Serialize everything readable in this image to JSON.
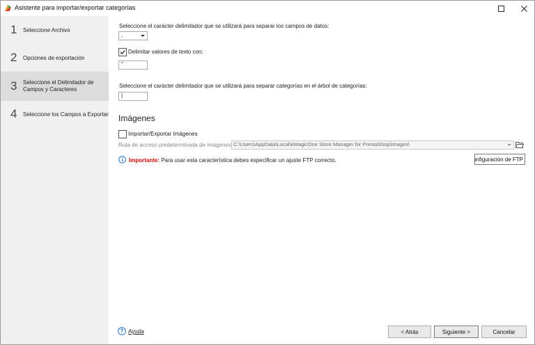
{
  "window": {
    "title": "Asistente para importar/exportar categorías"
  },
  "steps": [
    {
      "num": "1",
      "label_lines": [
        "Seleccione Archivo"
      ]
    },
    {
      "num": "2",
      "label_lines": [
        "Opciones de exportación"
      ]
    },
    {
      "num": "3",
      "label_lines": [
        "Seleccione el Delimitador de",
        "Campos y Caracteres"
      ]
    },
    {
      "num": "4",
      "label_lines": [
        "Seleccione los Campos a Exportar"
      ]
    }
  ],
  "active_step": 3,
  "delimiter": {
    "label": "Seleccione el carácter delimitador que se utilizará para separar los campos de datos:",
    "value": ","
  },
  "text_qualifier": {
    "checkbox_label": "Delimitar valores de texto con:",
    "checked": true,
    "value": "\""
  },
  "category_delimiter": {
    "label": "Seleccione el carácter delimitador que se utilizará para separar categorías en el árbol de categorías:",
    "value": "|"
  },
  "images": {
    "heading": "Imágenes",
    "checkbox_label": "Importar/Exportar Imágenes",
    "checked": false,
    "path_label": "Ruta de acceso predeterminada de imágenes",
    "path_value": "C:\\Users\\AppData\\Local\\eMagicOne Store Manager for PrestaShop\\images\\",
    "notice_prefix": "Importante:",
    "notice_text": " Para usar esta característica debes especificar un ajuste FTP correcto.",
    "ftp_button": "Configuración de FTP"
  },
  "footer": {
    "help": "Ayuda",
    "back": "< Atrás",
    "next": "Siguiente >",
    "cancel": "Cancelar"
  },
  "colors": {
    "important": "#d40000",
    "info": "#1e6fd0",
    "active_step_bg": "#dcdcdc",
    "sidebar_bg": "#f0f0f0"
  }
}
